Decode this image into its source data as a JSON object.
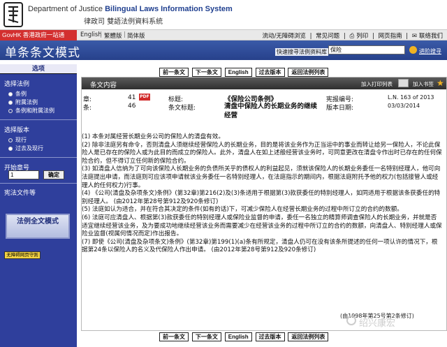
{
  "header": {
    "dept_en": "Department of Justice",
    "system_en": "Bilingual Laws Information System",
    "dept_zh": "律政司",
    "system_zh": "雙語法例資料系統"
  },
  "govbar": {
    "badge": "GovHK 香港政府一站通",
    "lang_en": "English",
    "lang_tc": "繁體版",
    "lang_sc": "简体版",
    "lang_sep": "|",
    "util_items": [
      "流动/无障碍浏览",
      "|",
      "常见问题",
      "|",
      "列印",
      "|",
      "网页指南",
      "|",
      "联络我们"
    ]
  },
  "titlebar": {
    "title": "单条条文模式",
    "search_label": "快速搜寻法例资料库",
    "search_value": "保险",
    "advanced_search": "进阶搜寻"
  },
  "sidebar": {
    "heading": "选项",
    "law_title": "选择法例",
    "law_options": [
      {
        "label": "条例",
        "selected": false
      },
      {
        "label": "附属法例",
        "selected": false
      },
      {
        "label": "条例和附属法例",
        "selected": true
      }
    ],
    "version_title": "选择版本",
    "version_options": [
      {
        "label": "现行",
        "selected": true
      },
      {
        "label": "过去及现行",
        "selected": false
      }
    ],
    "chapter_title": "开始章号",
    "chapter_value": "1",
    "ok_label": "确定",
    "constitutional": "宪法文件等",
    "fulltext_label": "法例全文模式",
    "nobarrier_label": "无障碍网页守则"
  },
  "nav": {
    "prev": "前一条文",
    "next": "下一条文",
    "english": "English",
    "past_version": "过去版本",
    "back_list": "返回法例列表"
  },
  "main": {
    "bar_title": "条文内容",
    "print_list": "加入打印列表",
    "bookmark": "加入书签",
    "pdf_label": "PDF",
    "chapter_label": "章:",
    "chapter_value": "41",
    "section_label": "条:",
    "section_value": "46",
    "title_label": "标题:",
    "title_value": "《保险公司条例》",
    "section_title_label": "条文标题:",
    "section_title_value": "清盘中保险人的长期业务的继续经营",
    "gazette_label": "宪报编号:",
    "gazette_value": "L.N. 163 of 2013",
    "version_date_label": "版本日期:",
    "version_date_value": "03/03/2014",
    "paragraphs": [
      "(1) 本条对属经营长期业务公司的保险人的清盘有效。",
      "(2) 除非法庭另有命令，否则清盘人须继续经营保险人的长期业务，目的是将该业务作为正当运中的事业而转让给另一保险人，不论此保险人是已存在的保险人或为此目的而成立的保险人。此外，清盘人在如上述般经营该业务时，可同意更改在清盘令作出时已存在的任何保险合约，但不得订立任何新的保险合约。",
      "(3) 如清盘人信纳为了可向该保险人长期业务的负债所关乎的债权人的利益起见，须就该保险人的长期业务委任一名特别经理人，他可向法庭提出申请，而法庭则可应该项申请就该业务委任一名特别经理人，在法庭指示的期间内，根据法庭附托予他的权力(包括接管人或经理人的任何权力)行事。",
      "(4) 《公司(清盘及杂项条文)条例》(第32章)第216(2)及(3)条适用于根据第(3)款获委任的特别经理人，如同适用于根据该条获委任的特别经理人。 (由2012年第28号第912及920条修订)",
      "(5) 法庭如认为适合，并在符合其决定的条件(如有的话)下，可减少保险人在经营长期业务的过程中所订立的合约的数额。",
      "(6) 法庭可应清盘人、根据第(3)款获委任的特别经理人或保险业监督的申请，委任一名独立的精算师调查保险人的长期业务，并就是否适宜继续经营该业务，及为要成功地继续经营该业务而需要减少在经营该业务的过程中所订立的合约的数额，向清盘人、特别经理人或保险业监督(视属何情况而定)作出报告。",
      "(7) 即使《公司(清盘及杂项条文)条例》(第32章)第199(1)(a)条有所规定，清盘人仍可在没有该条所提述的任何一项认许的情况下，根据第24条以保险人的名义及代保险人作出申请。 (由2012年第28号第912及920条修订)"
    ],
    "footnote": "(由1998年第25号第2条修订)",
    "watermark": "绍兴康宏"
  },
  "colors": {
    "brand_blue": "#2f3f9c",
    "govhk_red": "#d32f2f",
    "bar_dark": "#3a3a3a"
  }
}
